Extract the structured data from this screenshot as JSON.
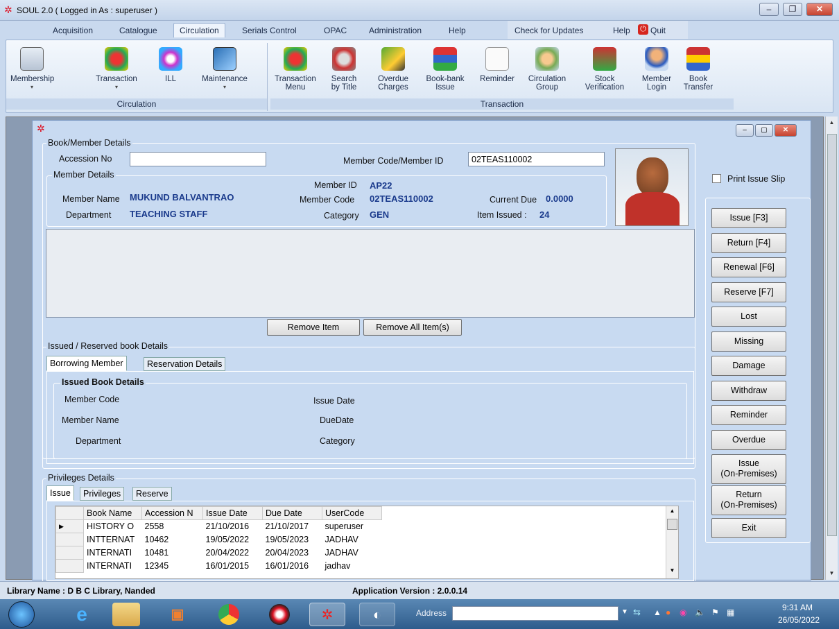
{
  "window": {
    "title": "SOUL 2.0  ( Logged in As : superuser )"
  },
  "menu": {
    "items": [
      "Acquisition",
      "Catalogue",
      "Circulation",
      "Serials Control",
      "OPAC",
      "Administration",
      "Help"
    ],
    "active": "Circulation",
    "check_updates": "Check for Updates",
    "help": "Help",
    "quit": "Quit"
  },
  "ribbon": {
    "circulation_group": "Circulation",
    "transaction_group": "Transaction",
    "circulation_buttons": [
      "Membership",
      "Transaction",
      "ILL",
      "Maintenance"
    ],
    "transaction_buttons": [
      [
        "Transaction",
        "Menu"
      ],
      [
        "Search",
        "by Title"
      ],
      [
        "Overdue",
        "Charges"
      ],
      [
        "Book-bank",
        "Issue"
      ],
      [
        "Reminder",
        ""
      ],
      [
        "Circulation",
        "Group"
      ],
      [
        "Stock",
        "Verification"
      ],
      [
        "Member",
        "Login"
      ],
      [
        "Book",
        "Transfer"
      ]
    ]
  },
  "book_member": {
    "legend": "Book/Member Details",
    "accession_label": "Accession No",
    "accession_value": "",
    "member_code_label": "Member Code/Member ID",
    "member_code_value": "02TEAS110002"
  },
  "member_details": {
    "legend": "Member Details",
    "name_label": "Member Name",
    "name_value": "MUKUND BALVANTRAO",
    "dept_label": "Department",
    "dept_value": "TEACHING STAFF",
    "id_label": "Member ID",
    "id_value": "AP22",
    "code_label": "Member Code",
    "code_value": "02TEAS110002",
    "category_label": "Category",
    "category_value": "GEN",
    "due_label": "Current Due",
    "due_value": "0.0000",
    "issued_label": "Item Issued :",
    "issued_value": "24"
  },
  "print_slip": "Print Issue Slip",
  "remove_item": "Remove Item",
  "remove_all": "Remove All Item(s)",
  "side_buttons": [
    "Issue [F3]",
    "Return [F4]",
    "Renewal [F6]",
    "Reserve [F7]",
    "Lost",
    "Missing",
    "Damage",
    "Withdraw",
    "Reminder",
    "Overdue",
    "Issue\n(On-Premises)",
    "Return\n(On-Premises)",
    "Exit"
  ],
  "issued_reserved": {
    "legend": "Issued / Reserved book Details",
    "tabs": [
      "Borrowing Member",
      "Reservation Details"
    ],
    "inner_legend": "Issued Book Details",
    "member_code": "Member Code",
    "member_name": "Member Name",
    "department": "Department",
    "issue_date": "Issue Date",
    "due_date": "DueDate",
    "category": "Category"
  },
  "privileges": {
    "legend": "Privileges Details",
    "tabs": [
      "Issue",
      "Privileges",
      "Reserve"
    ],
    "columns": [
      "Book Name",
      "Accession N",
      "Issue Date",
      "Due Date",
      "UserCode"
    ],
    "rows": [
      [
        "HISTORY O",
        "2558",
        "21/10/2016",
        "21/10/2017",
        "superuser"
      ],
      [
        "INTTERNAT",
        "10462",
        "19/05/2022",
        "19/05/2023",
        "JADHAV"
      ],
      [
        "INTERNATI",
        "10481",
        "20/04/2022",
        "20/04/2023",
        "JADHAV"
      ],
      [
        "INTERNATI",
        "12345",
        "16/01/2015",
        "16/01/2016",
        "jadhav"
      ]
    ]
  },
  "status": {
    "library": "Library Name : D B C Library, Nanded",
    "version": "Application Version : 2.0.0.14"
  },
  "taskbar": {
    "address": "Address",
    "time": "9:31 AM",
    "date": "26/05/2022"
  }
}
